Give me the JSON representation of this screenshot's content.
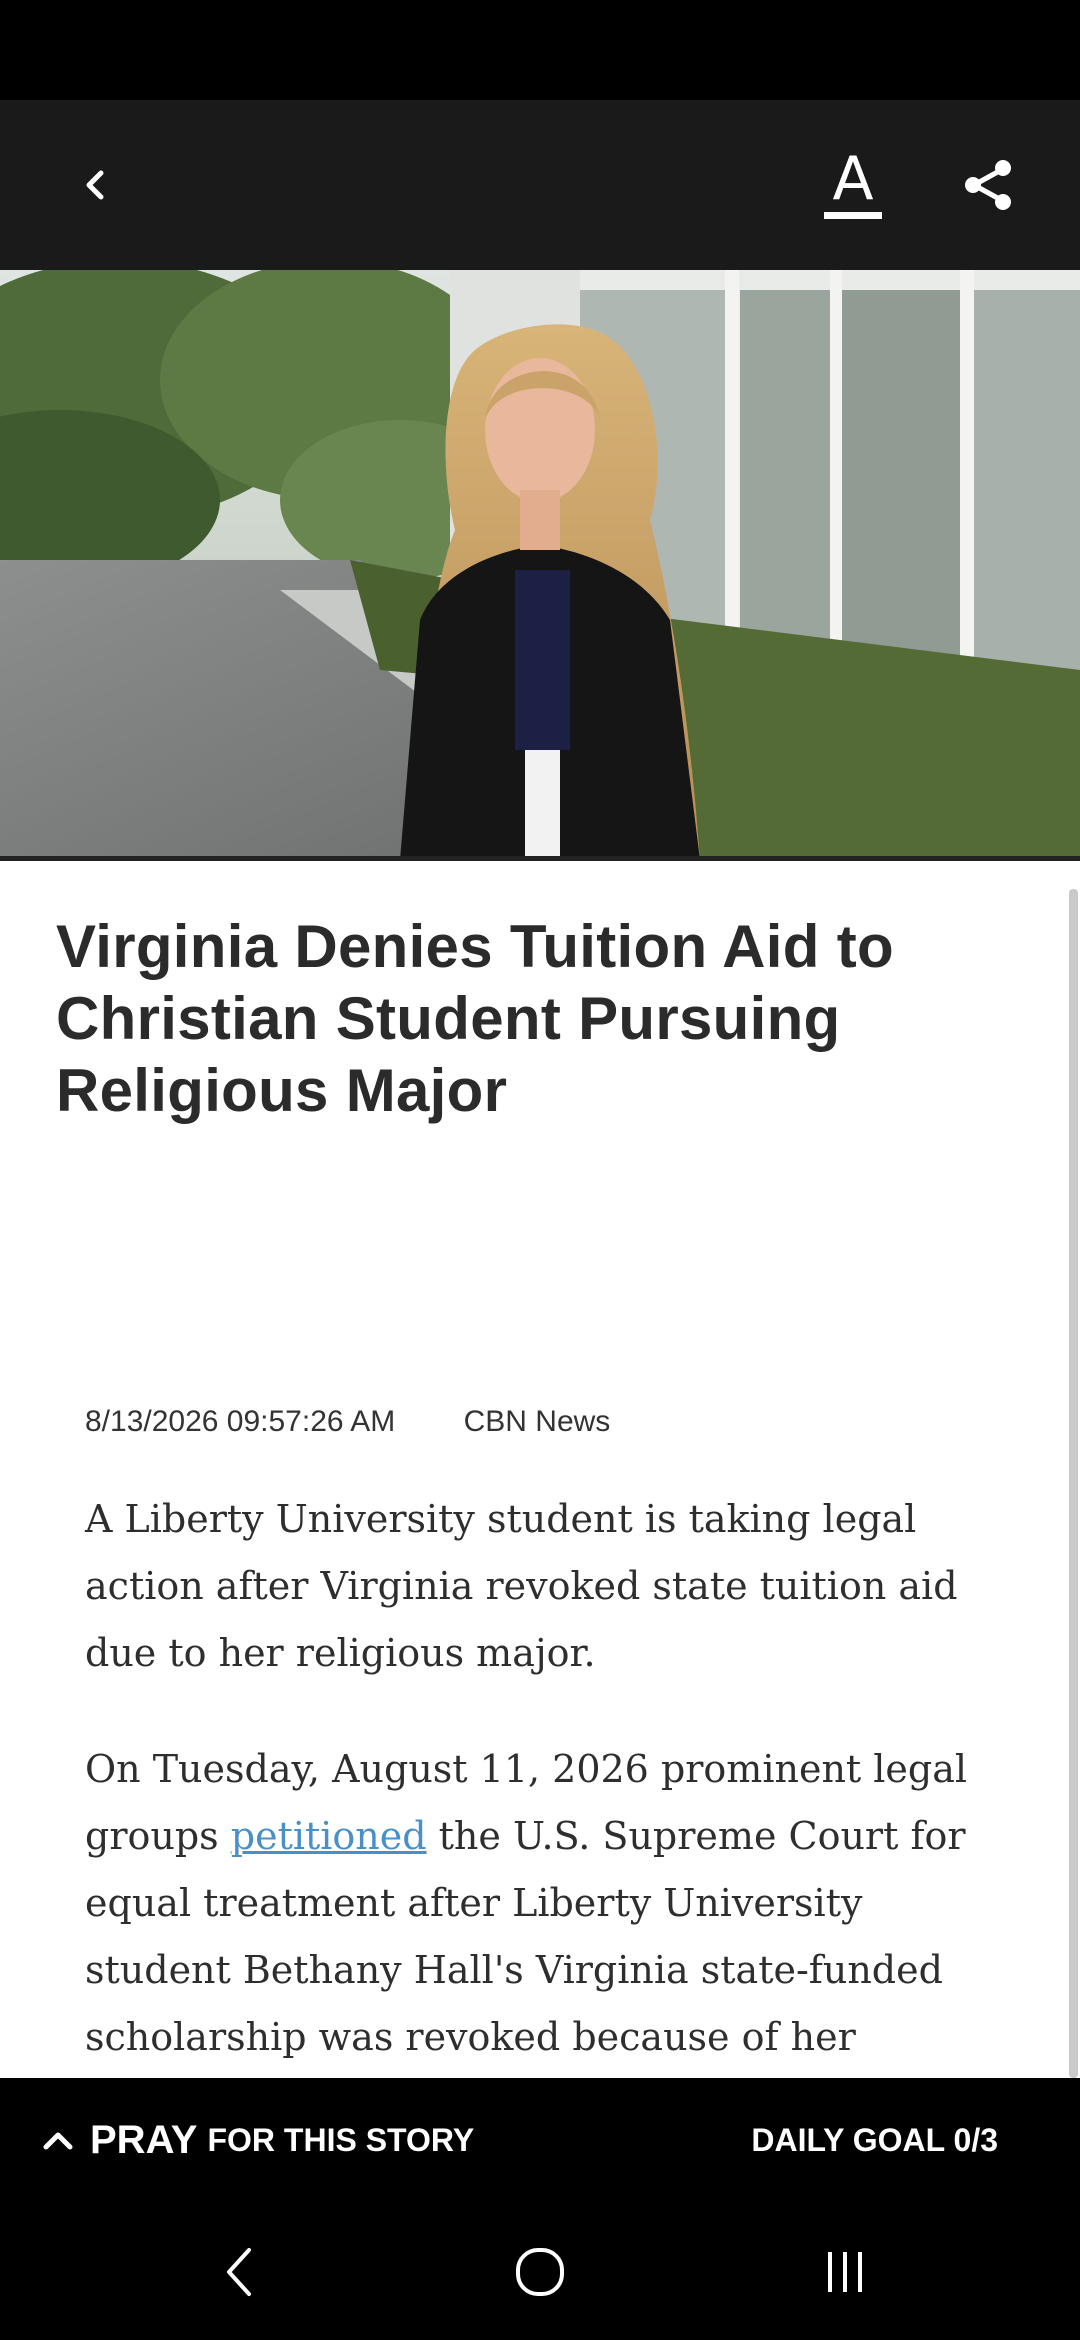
{
  "article": {
    "headline": "Virginia Denies Tuition Aid to Christian Student Pursuing Religious Major",
    "timestamp": "8/13/2026 09:57:26 AM",
    "source": "CBN News",
    "paragraph1": "A Liberty University student is taking legal action after Virginia revoked state tuition aid due to her religious major.",
    "paragraph2_before": "On Tuesday, August 11, 2026 prominent legal groups ",
    "paragraph2_link": "petitioned",
    "paragraph2_after": " the U.S. Supreme Court for equal treatment after Liberty University student Bethany Hall's Virginia state-funded scholarship was revoked because of her"
  },
  "toolbar": {
    "font_size_label": "A"
  },
  "pray_bar": {
    "pray_word": "PRAY",
    "pray_rest": "FOR THIS STORY",
    "daily_goal": "DAILY GOAL 0/3"
  },
  "icons": {
    "back": "chevron-left-icon",
    "font_size": "text-size-icon",
    "share": "share-icon",
    "pray_expand": "chevron-up-icon",
    "nav_back": "nav-back-icon",
    "nav_home": "nav-home-icon",
    "nav_recents": "nav-recents-icon"
  },
  "colors": {
    "app_bar": "#1a1a1a",
    "link": "#4a90c8",
    "headline": "#2b2b2b"
  }
}
